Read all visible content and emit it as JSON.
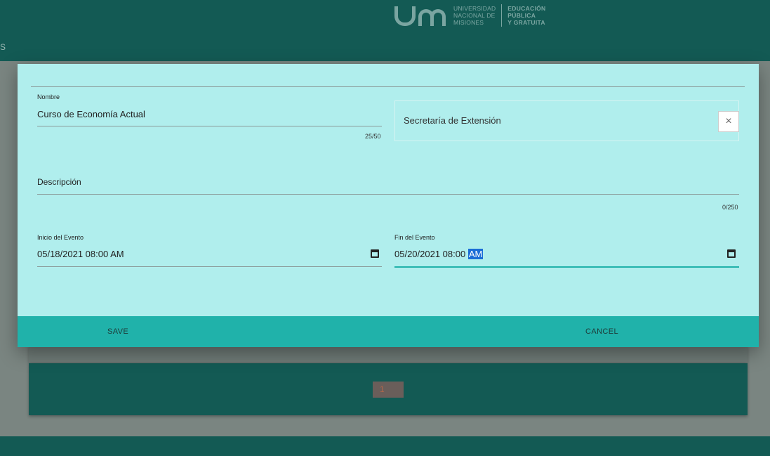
{
  "header": {
    "logo_line1": "UNIVERSIDAD",
    "logo_line2": "NACIONAL DE",
    "logo_line3": "MISIONES",
    "logo_tag1": "EDUCACIÓN",
    "logo_tag2": "PÚBLICA",
    "logo_tag3": "Y GRATUITA",
    "nav_fragment": "S"
  },
  "dialog": {
    "nombre": {
      "label": "Nombre",
      "value": "Curso de Economía Actual",
      "counter": "25/50"
    },
    "organizacion": {
      "value": "Secretaría de Extensión",
      "clear_icon": "×"
    },
    "descripcion": {
      "placeholder": "Descripción",
      "counter": "0/250"
    },
    "inicio": {
      "label": "Inicio del Evento",
      "value": "05/18/2021 08:00  AM"
    },
    "fin": {
      "label": "Fin del Evento",
      "value_prefix": "05/20/2021 08:00 ",
      "value_selected": "AM"
    },
    "actions": {
      "save": "SAVE",
      "cancel": "CANCEL"
    }
  },
  "pagination": {
    "current_page": "1"
  },
  "colors": {
    "header_bg": "#135a54",
    "dialog_bg": "#b0eeed",
    "action_bar": "#20b2aa",
    "focus_underline": "#20b2aa",
    "selection": "#1a6dd6"
  }
}
